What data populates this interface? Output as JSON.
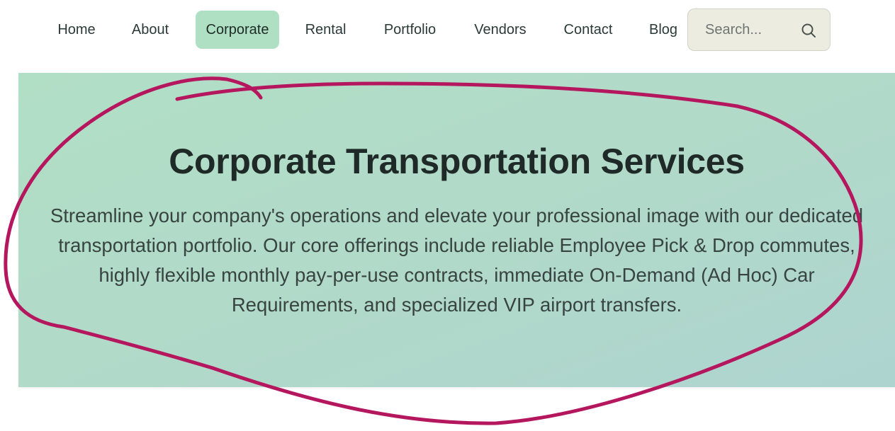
{
  "nav": {
    "items": [
      {
        "label": "Home"
      },
      {
        "label": "About"
      },
      {
        "label": "Corporate",
        "active": true
      },
      {
        "label": "Rental"
      },
      {
        "label": "Portfolio"
      },
      {
        "label": "Vendors"
      },
      {
        "label": "Contact"
      },
      {
        "label": "Blog"
      }
    ],
    "active_color": "#b0e0c3"
  },
  "search": {
    "placeholder": "Search...",
    "value": "",
    "icon": "search-icon"
  },
  "hero": {
    "title": "Corporate Transportation Services",
    "description": "Streamline your company's operations and elevate your professional image with our dedicated transportation portfolio. Our core offerings include reliable Employee Pick & Drop commutes, highly flexible monthly pay-per-use contracts, immediate On-Demand (Ad Hoc) Car Requirements, and specialized VIP airport transfers.",
    "background_color": "#b1dcc8"
  },
  "annotation": {
    "type": "hand-drawn-circle",
    "color": "#b5175e"
  }
}
